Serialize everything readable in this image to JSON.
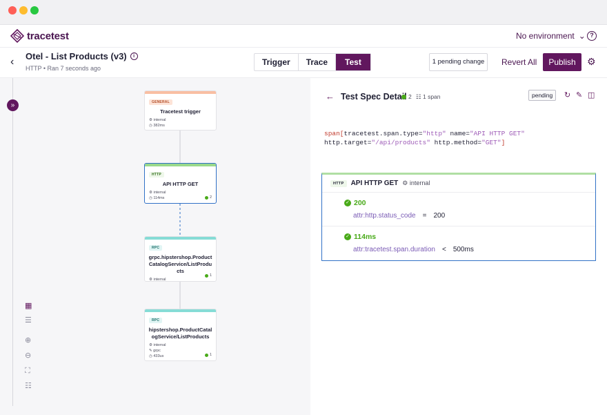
{
  "app": {
    "logo_text": "tracetest",
    "environment": "No environment",
    "help": "?"
  },
  "header": {
    "title": "Otel - List Products (v3)",
    "subtitle": "HTTP • Ran 7 seconds ago",
    "tabs": [
      {
        "label": "Trigger",
        "active": false
      },
      {
        "label": "Trace",
        "active": false
      },
      {
        "label": "Test",
        "active": true
      }
    ],
    "pending_changes": "1 pending change",
    "revert_label": "Revert All",
    "publish_label": "Publish"
  },
  "trace": {
    "nodes": [
      {
        "tag": "GENERAL",
        "tag_color": "#fde3d7",
        "bar_color": "#f9bfa3",
        "name": "Tracetest trigger",
        "meta": [
          "internal",
          "382ms"
        ],
        "badge": ""
      },
      {
        "tag": "HTTP",
        "tag_color": "#eef7ea",
        "bar_color": "#9ad98b",
        "name": "API HTTP GET",
        "meta": [
          "internal",
          "114ms"
        ],
        "badge": "2"
      },
      {
        "tag": "RPC",
        "tag_color": "#e1f5f4",
        "bar_color": "#86dcd6",
        "name": "grpc.hipstershop.ProductCatalogService/ListProducts",
        "meta": [
          "internal",
          "95ms"
        ],
        "badge": "1"
      },
      {
        "tag": "RPC",
        "tag_color": "#e1f5f4",
        "bar_color": "#86dcd6",
        "name": "hipstershop.ProductCatalogService/ListProducts",
        "meta": [
          "internal",
          "grpc",
          "433us"
        ],
        "badge": "1"
      }
    ]
  },
  "spec": {
    "title": "Test Spec Detail",
    "passed": "2",
    "span_count": "1 span",
    "status": "pending",
    "selector": {
      "prefix": "span[",
      "a1_key": "tracetest.span.type",
      "a1_val": "\"http\"",
      "a2_key": "name",
      "a2_val": "\"API HTTP GET\"",
      "a3_key": "http.target",
      "a3_val": "\"/api/products\"",
      "a4_key": "http.method",
      "a4_val": "\"GET\"",
      "suffix": "]"
    },
    "span_tag": "HTTP",
    "span_name": "API HTTP GET",
    "span_type": "internal",
    "assertions": [
      {
        "result": "200",
        "attr": "attr:http.status_code",
        "op": "=",
        "value": "200"
      },
      {
        "result": "114ms",
        "attr": "attr:tracetest.span.duration",
        "op": "<",
        "value": "500ms"
      }
    ]
  },
  "colors": {
    "brand": "#61175e",
    "pass": "#49aa19",
    "selected": "#2f70c6"
  }
}
